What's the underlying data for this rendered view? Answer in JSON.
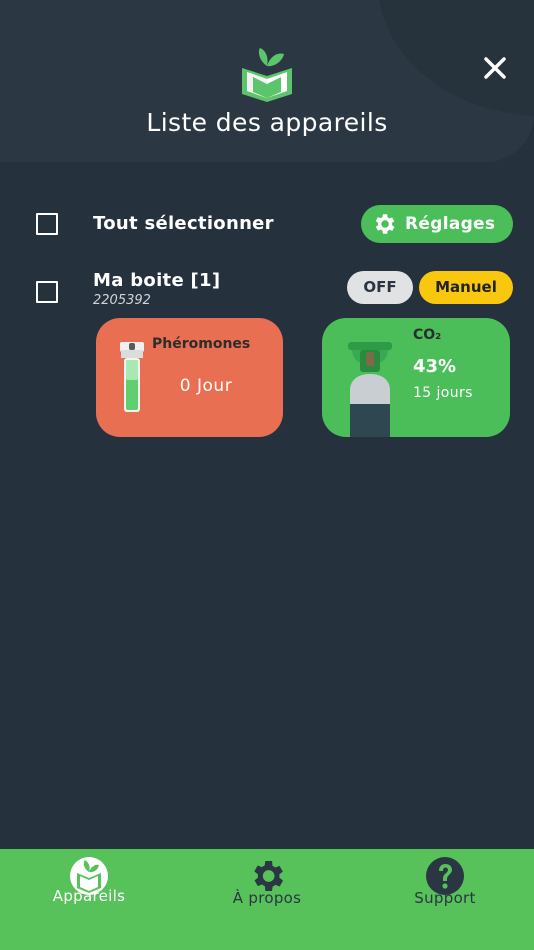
{
  "header": {
    "title": "Liste des appareils",
    "logo_icon": "book-leaf-logo-icon",
    "close_icon": "close-icon"
  },
  "toolbar": {
    "select_all_label": "Tout sélectionner",
    "select_all_checked": false,
    "settings_label": "Réglages",
    "settings_icon": "gear-icon"
  },
  "devices": [
    {
      "name": "Ma boite [1]",
      "id": "2205392",
      "checked": false,
      "off_label": "OFF",
      "mode_label": "Manuel",
      "pheromones": {
        "title": "Phéromones",
        "value": "0 Jour",
        "icon": "pheromone-tube-icon"
      },
      "co2": {
        "title": "CO₂",
        "percent": "43%",
        "days": "15 jours",
        "icon": "gas-bottle-icon"
      }
    }
  ],
  "bottom_nav": [
    {
      "label": "Appareils",
      "icon": "book-leaf-icon",
      "active": true
    },
    {
      "label": "À propos",
      "icon": "gear-icon",
      "active": false
    },
    {
      "label": "Support",
      "icon": "question-icon",
      "active": false
    }
  ],
  "colors": {
    "background": "#25313d",
    "accent_green": "#4bbe5a",
    "pheromone_card": "#e96f52",
    "manual_yellow": "#f9c80e",
    "off_grey": "#e1e2e4"
  }
}
